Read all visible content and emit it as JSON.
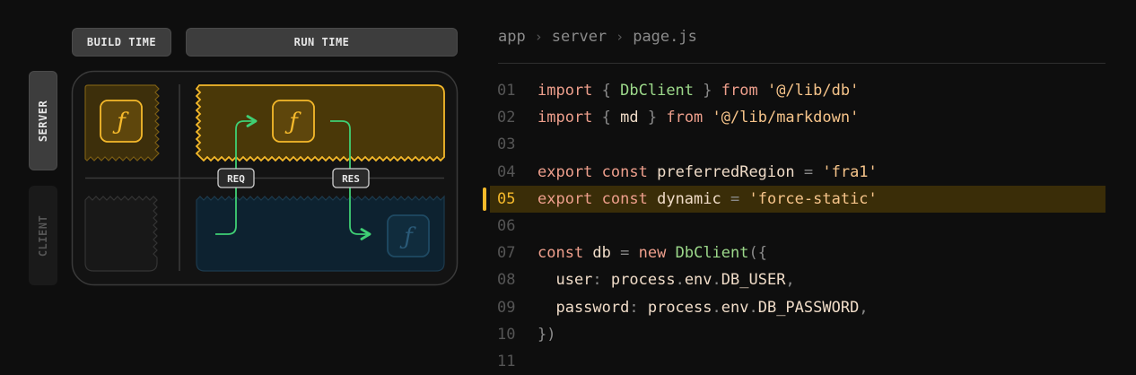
{
  "tabs": {
    "build_time": "BUILD TIME",
    "run_time": "RUN TIME"
  },
  "side": {
    "server": "SERVER",
    "client": "CLIENT"
  },
  "function_icon": "ƒ",
  "tags": {
    "req": "REQ",
    "res": "RES"
  },
  "breadcrumb": [
    "app",
    "server",
    "page.js"
  ],
  "colors": {
    "accent": "#f5b92b",
    "arrow": "#3fcf74",
    "client_fill": "#0d2230"
  },
  "highlighted_line": "05",
  "code": [
    {
      "n": "01",
      "tokens": [
        [
          "kw",
          "import"
        ],
        [
          "pn",
          " { "
        ],
        [
          "cls",
          "DbClient"
        ],
        [
          "pn",
          " } "
        ],
        [
          "kw",
          "from"
        ],
        [
          "id",
          " "
        ],
        [
          "str",
          "'@/lib/db'"
        ]
      ]
    },
    {
      "n": "02",
      "tokens": [
        [
          "kw",
          "import"
        ],
        [
          "pn",
          " { "
        ],
        [
          "id",
          "md"
        ],
        [
          "pn",
          " } "
        ],
        [
          "kw",
          "from"
        ],
        [
          "id",
          " "
        ],
        [
          "str",
          "'@/lib/markdown'"
        ]
      ]
    },
    {
      "n": "03",
      "tokens": []
    },
    {
      "n": "04",
      "tokens": [
        [
          "kw",
          "export"
        ],
        [
          "id",
          " "
        ],
        [
          "kw",
          "const"
        ],
        [
          "id",
          " preferredRegion "
        ],
        [
          "op",
          "="
        ],
        [
          "id",
          " "
        ],
        [
          "str",
          "'fra1'"
        ]
      ]
    },
    {
      "n": "05",
      "tokens": [
        [
          "kw",
          "export"
        ],
        [
          "id",
          " "
        ],
        [
          "kw",
          "const"
        ],
        [
          "id",
          " dynamic "
        ],
        [
          "op",
          "="
        ],
        [
          "id",
          " "
        ],
        [
          "str",
          "'force-static'"
        ]
      ]
    },
    {
      "n": "06",
      "tokens": []
    },
    {
      "n": "07",
      "tokens": [
        [
          "kw",
          "const"
        ],
        [
          "id",
          " db "
        ],
        [
          "op",
          "="
        ],
        [
          "id",
          " "
        ],
        [
          "kw",
          "new"
        ],
        [
          "id",
          " "
        ],
        [
          "cls",
          "DbClient"
        ],
        [
          "pn",
          "({"
        ]
      ]
    },
    {
      "n": "08",
      "tokens": [
        [
          "id",
          "  user"
        ],
        [
          "pn",
          ": "
        ],
        [
          "id",
          "process"
        ],
        [
          "pn",
          "."
        ],
        [
          "id",
          "env"
        ],
        [
          "pn",
          "."
        ],
        [
          "id",
          "DB_USER"
        ],
        [
          "pn",
          ","
        ]
      ]
    },
    {
      "n": "09",
      "tokens": [
        [
          "id",
          "  password"
        ],
        [
          "pn",
          ": "
        ],
        [
          "id",
          "process"
        ],
        [
          "pn",
          "."
        ],
        [
          "id",
          "env"
        ],
        [
          "pn",
          "."
        ],
        [
          "id",
          "DB_PASSWORD"
        ],
        [
          "pn",
          ","
        ]
      ]
    },
    {
      "n": "10",
      "tokens": [
        [
          "pn",
          "})"
        ]
      ]
    },
    {
      "n": "11",
      "tokens": []
    }
  ]
}
